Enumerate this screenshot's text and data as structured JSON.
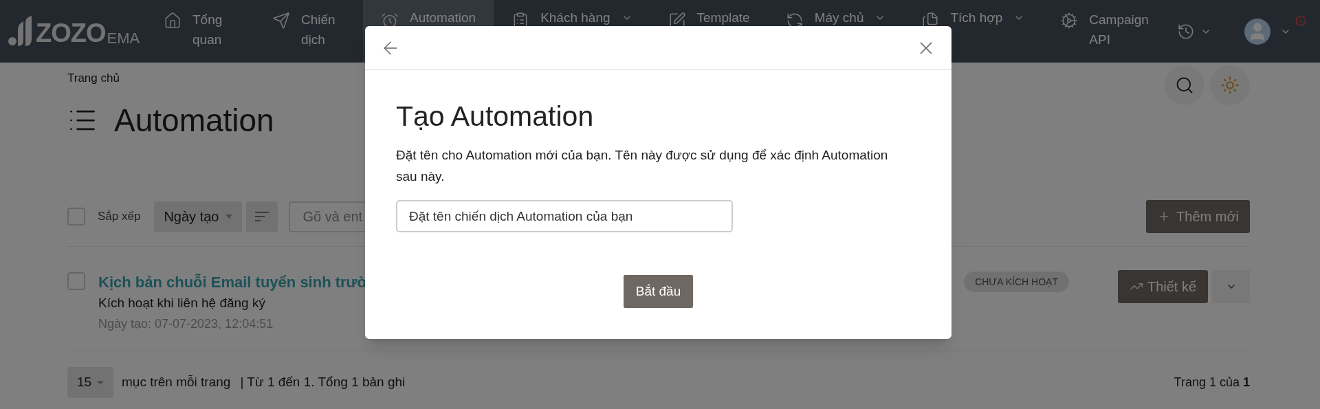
{
  "nav": {
    "logo": {
      "name": "ZOZO",
      "suffix": "EMA"
    },
    "items": [
      {
        "label": "Tổng quan",
        "kind": "two-line",
        "selected": false,
        "dropdown": false
      },
      {
        "label": "Chiến dịch",
        "kind": "two-line",
        "selected": false,
        "dropdown": false
      },
      {
        "label": "Automation",
        "kind": "one-line",
        "selected": true,
        "dropdown": false
      },
      {
        "label": "Khách hàng",
        "kind": "one-line",
        "selected": false,
        "dropdown": true
      },
      {
        "label": "Template",
        "kind": "one-line",
        "selected": false,
        "dropdown": false
      },
      {
        "label": "Máy chủ",
        "kind": "one-line",
        "selected": false,
        "dropdown": true
      },
      {
        "label": "Tích hợp",
        "kind": "one-line",
        "selected": false,
        "dropdown": true
      },
      {
        "label": "Campaign API",
        "kind": "two-line",
        "selected": false,
        "dropdown": false
      }
    ]
  },
  "breadcrumb": "Trang chủ",
  "title": "Automation",
  "toolbar": {
    "select_all": {
      "checked": false
    },
    "sort_label": "Sắp xếp",
    "sort_select": "Ngày tạo",
    "search": {
      "placeholder": "Gõ và ent"
    },
    "add_button": "Thêm mới"
  },
  "rows": [
    {
      "checked": false,
      "title": "Kịch bản chuỗi Email tuyển sinh trườ",
      "trigger": "Kích hoạt khi liên hệ đăng ký",
      "created": "Ngày tạo: 07-07-2023, 12:04:51",
      "status": "CHƯA KÍCH HOẠT",
      "design_button": "Thiết kế"
    }
  ],
  "footer": {
    "per_page": "15",
    "per_page_label": "mục trên mỗi trang",
    "range": "| Từ 1 đến 1. Tổng 1 bản ghi",
    "page": "Trang 1 của **1**"
  },
  "modal": {
    "title": "Tạo Automation",
    "description": "Đặt tên cho Automation mới của bạn. Tên này được sử dụng để xác định Automation sau này.",
    "input": {
      "placeholder": "Đặt tên chiến dịch Automation của bạn"
    },
    "button": "Bắt đầu"
  }
}
